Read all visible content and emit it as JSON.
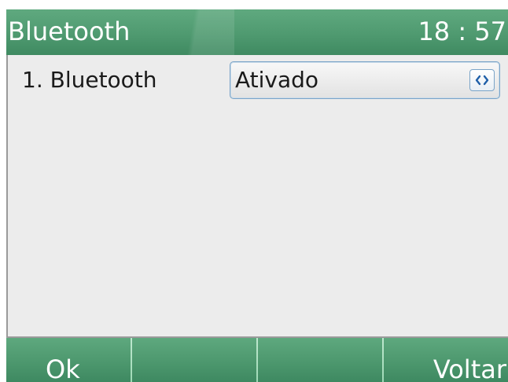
{
  "header": {
    "title": "Bluetooth",
    "time": "18 : 57"
  },
  "settings": {
    "rows": [
      {
        "label": "1. Bluetooth",
        "value": "Ativado",
        "control_icon": "left-right-chevrons-icon"
      }
    ]
  },
  "softkeys": {
    "ok": "Ok",
    "key2": "",
    "key3": "",
    "back": "Voltar"
  },
  "colors": {
    "bar_green": "#4f9a70",
    "content_bg": "#ececec",
    "select_border": "#7aa4c8",
    "arrow_color": "#1f5fa8"
  }
}
